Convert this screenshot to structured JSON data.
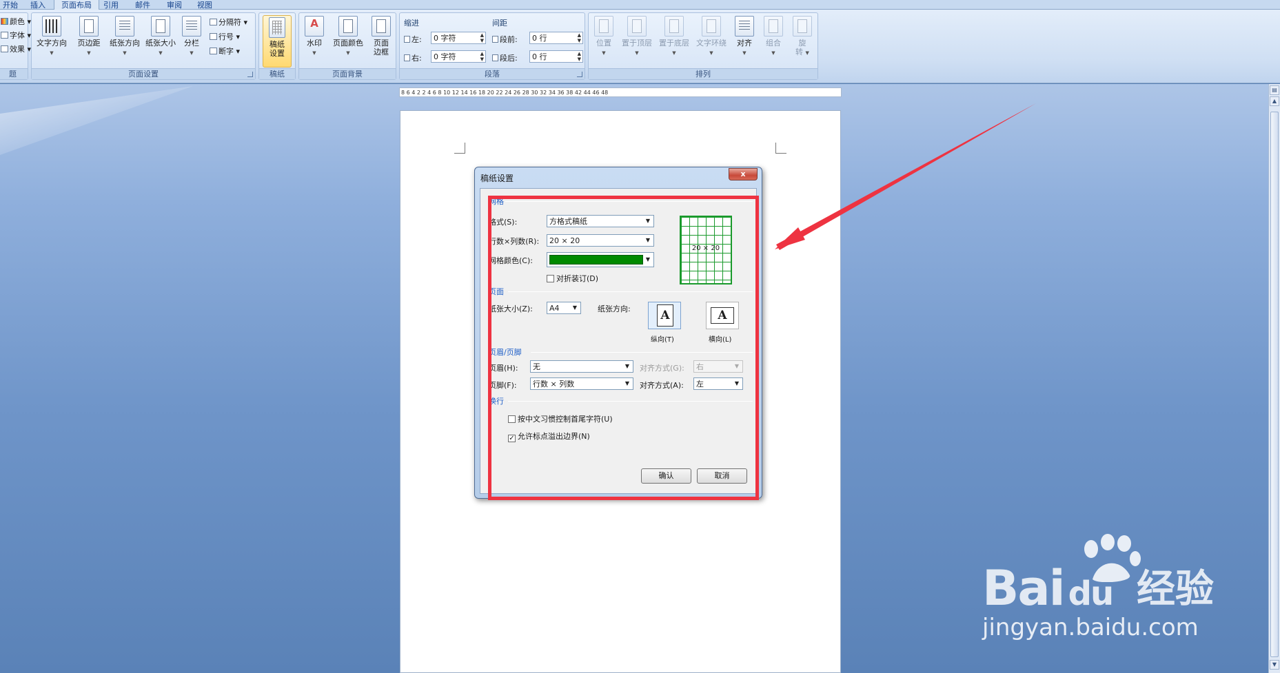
{
  "tabs": [
    "开始",
    "插入",
    "页面布局",
    "引用",
    "邮件",
    "审阅",
    "视图"
  ],
  "active_tab_index": 2,
  "ribbon": {
    "theme_group": {
      "items": [
        "颜色",
        "字体",
        "效果"
      ],
      "label": "题"
    },
    "page_setup": {
      "buttons": [
        "文字方向",
        "页边距",
        "纸张方向",
        "纸张大小",
        "分栏"
      ],
      "small": [
        "分隔符",
        "行号",
        "断字"
      ],
      "label": "页面设置"
    },
    "manuscript": {
      "button_line1": "稿纸",
      "button_line2": "设置",
      "label": "稿纸"
    },
    "page_background": {
      "buttons": [
        "水印",
        "页面颜色"
      ],
      "border_line1": "页面",
      "border_line2": "边框",
      "label": "页面背景"
    },
    "paragraph": {
      "indent_title": "缩进",
      "spacing_title": "间距",
      "indent_left_label": "左:",
      "indent_left_value": "0 字符",
      "indent_right_label": "右:",
      "indent_right_value": "0 字符",
      "space_before_label": "段前:",
      "space_before_value": "0 行",
      "space_after_label": "段后:",
      "space_after_value": "0 行",
      "label": "段落"
    },
    "arrange": {
      "buttons": [
        "位置",
        "置于顶层",
        "置于底层",
        "文字环绕",
        "对齐",
        "组合"
      ],
      "rotate_line1": "旋",
      "rotate_line2": "转",
      "label": "排列"
    }
  },
  "ruler": "8  6  4  2     2  4  6  8  10  12  14  16  18  20  22  24  26  28  30  32  34  36  38    42  44  46  48",
  "dialog": {
    "title": "稿纸设置",
    "close": "x",
    "grid_section": "网格",
    "style_label": "格式(S):",
    "style_value": "方格式稿纸",
    "rowscols_label": "行数×列数(R):",
    "rowscols_value": "20 × 20",
    "grid_color_label": "网格颜色(C):",
    "grid_color_hex": "#008a00",
    "fold_binding": "对折装订(D)",
    "fold_binding_checked": false,
    "preview_label": "20 × 20",
    "page_section": "页面",
    "paper_size_label": "纸张大小(Z):",
    "paper_size_value": "A4",
    "orientation_label": "纸张方向:",
    "portrait": "纵向(T)",
    "landscape": "横向(L)",
    "header_footer_section": "页眉/页脚",
    "header_label": "页眉(H):",
    "header_value": "无",
    "header_align_label": "对齐方式(G):",
    "header_align_value": "右",
    "footer_label": "页脚(F):",
    "footer_value": "行数 × 列数",
    "footer_align_label": "对齐方式(A):",
    "footer_align_value": "左",
    "wrap_section": "换行",
    "chinese_rule": "按中文习惯控制首尾字符(U)",
    "chinese_rule_checked": false,
    "allow_punct": "允许标点溢出边界(N)",
    "allow_punct_checked": true,
    "ok": "确认",
    "cancel": "取消"
  },
  "watermark": {
    "brand": "Bai",
    "brand_tail": "du",
    "brand_cn": "经验",
    "url": "jingyan.baidu.com"
  },
  "colors": {
    "highlight_box": "#ee3341",
    "arrow": "#ee3341",
    "grid_green": "#1a9a2c"
  }
}
